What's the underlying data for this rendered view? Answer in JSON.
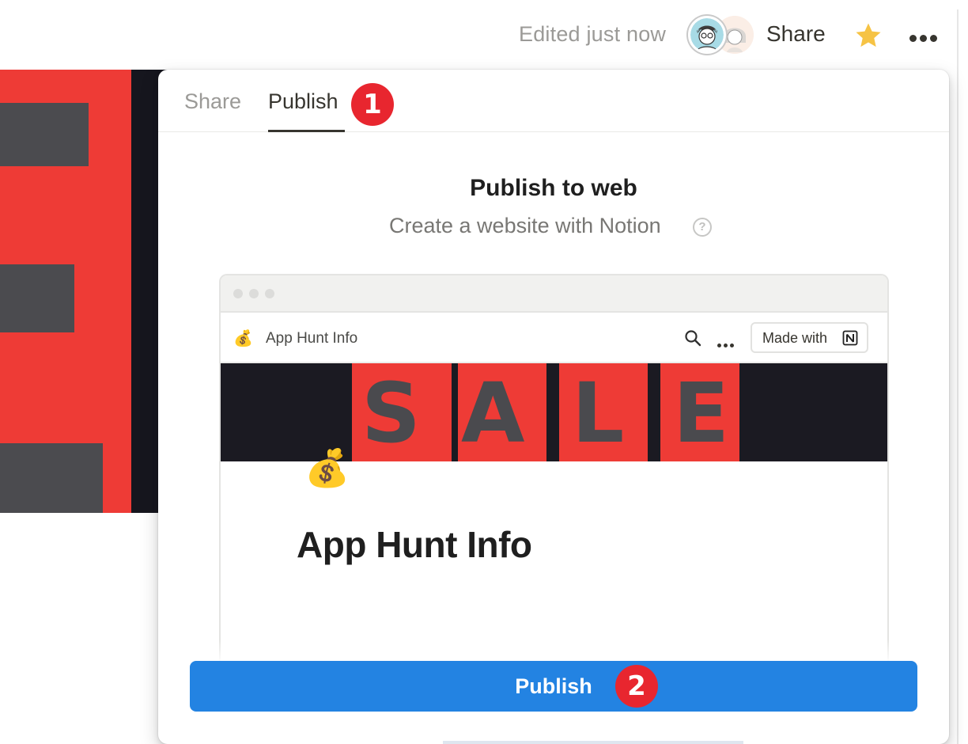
{
  "topbar": {
    "edited": "Edited just now",
    "share": "Share",
    "icons": [
      "avatar-user",
      "avatar-collaborator",
      "star-icon",
      "more-icon"
    ]
  },
  "popup": {
    "tabs": [
      {
        "label": "Share",
        "active": false
      },
      {
        "label": "Publish",
        "active": true
      }
    ],
    "title": "Publish to web",
    "subtitle": "Create a website with Notion",
    "preview": {
      "page_emoji": "💰",
      "site_title": "App Hunt Info",
      "made_with": "Made with",
      "cover_text": "SALE",
      "page_title": "App Hunt Info"
    },
    "publish_button": "Publish"
  },
  "annotations": {
    "step1": "1",
    "step2": "2",
    "badge_color": "#e8262f"
  },
  "colors": {
    "accent": "#2383e2",
    "text": "#37352f",
    "muted": "#9b9a97",
    "cover_red": "#ee3b36"
  }
}
